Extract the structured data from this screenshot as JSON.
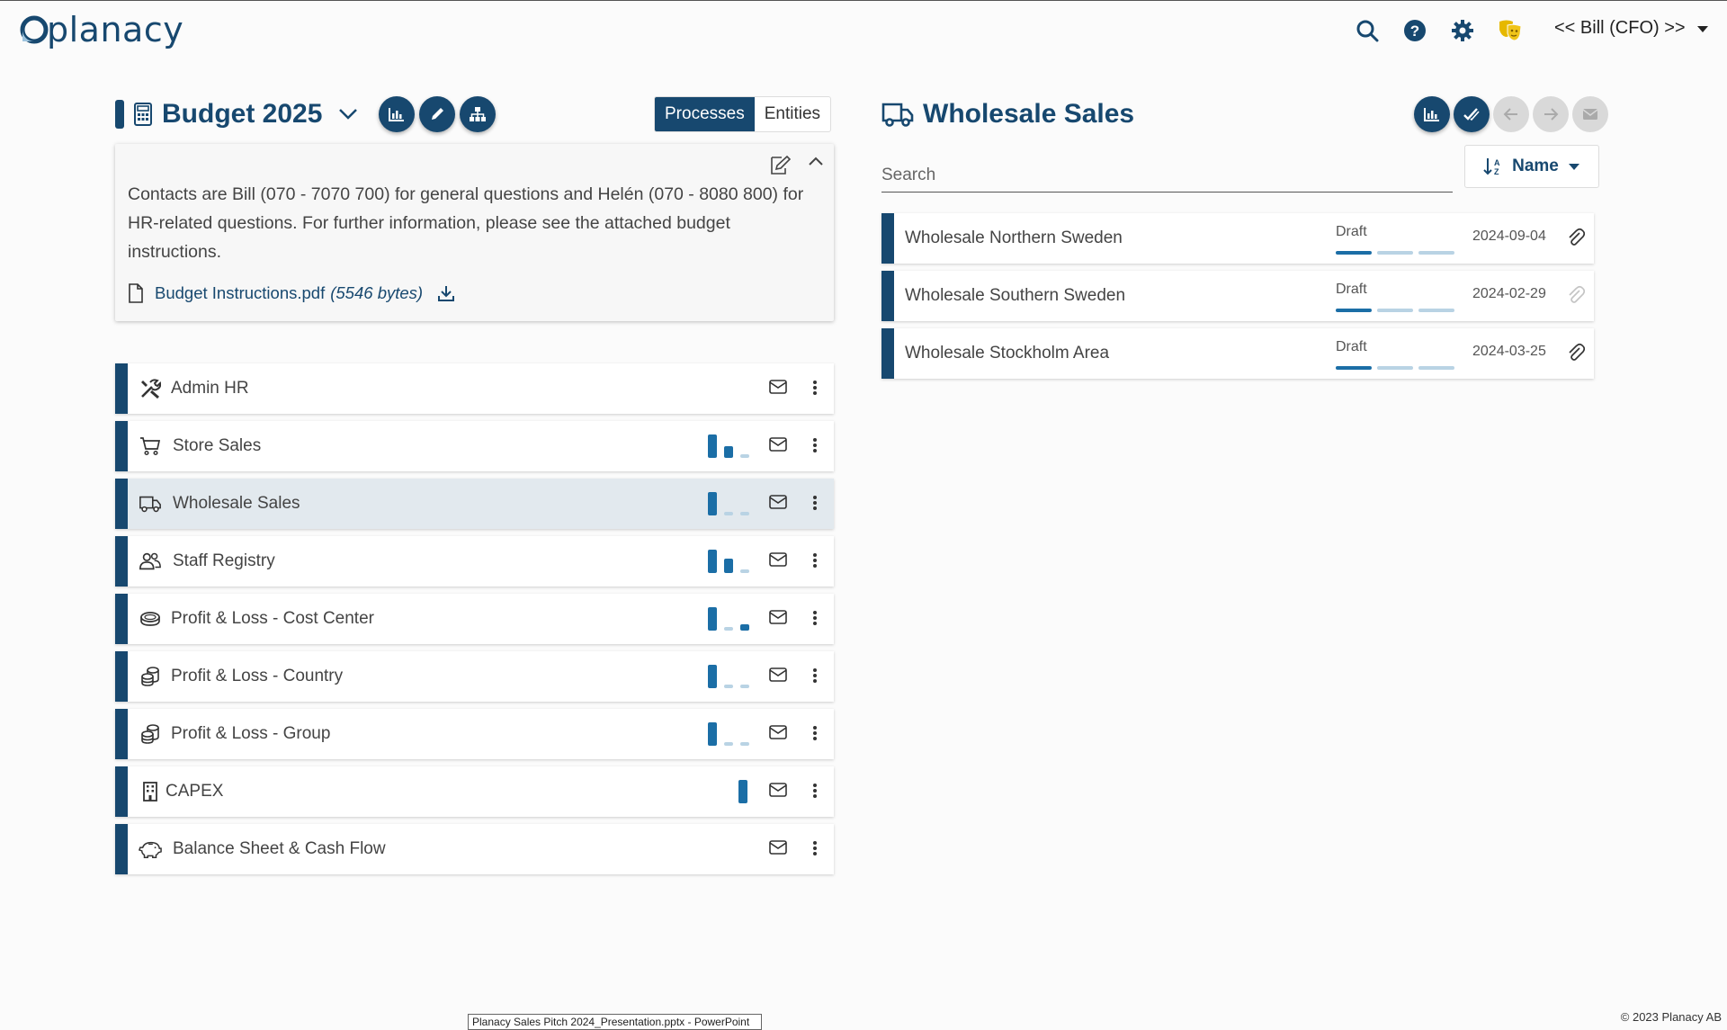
{
  "app": {
    "logo_text": "planacy",
    "user_label": "<< Bill (CFO) >>"
  },
  "left": {
    "title": "Budget 2025",
    "tabs": {
      "processes": "Processes",
      "entities": "Entities"
    },
    "info_text": "Contacts are Bill  (070 - 7070 700) for general questions and Helén (070 - 8080 800) for HR-related questions. For further information, please see the attached budget instructions.",
    "attachment": {
      "name": "Budget Instructions.pdf",
      "size": "(5546 bytes)"
    },
    "processes": [
      {
        "label": "Admin HR",
        "icon": "tools-icon",
        "progress": []
      },
      {
        "label": "Store Sales",
        "icon": "cart-icon",
        "progress": [
          1,
          0.5,
          0.15
        ]
      },
      {
        "label": "Wholesale Sales",
        "icon": "truck-icon",
        "progress": [
          1,
          0.15,
          0.15
        ],
        "selected": true
      },
      {
        "label": "Staff Registry",
        "icon": "users-icon",
        "progress": [
          1,
          0.6,
          0.15
        ]
      },
      {
        "label": "Profit & Loss - Cost Center",
        "icon": "coins-icon",
        "progress": [
          1,
          0.15,
          0.25
        ]
      },
      {
        "label": "Profit & Loss - Country",
        "icon": "coins-stack-icon",
        "progress": [
          1,
          0.15,
          0.15
        ]
      },
      {
        "label": "Profit & Loss - Group",
        "icon": "coins-stack-icon",
        "progress": [
          1,
          0.15,
          0.15
        ]
      },
      {
        "label": "CAPEX",
        "icon": "building-icon",
        "progress": [
          1
        ]
      },
      {
        "label": "Balance Sheet & Cash Flow",
        "icon": "piggy-bank-icon",
        "progress": []
      }
    ]
  },
  "right": {
    "title": "Wholesale Sales",
    "search_placeholder": "Search",
    "sort_label": "Name",
    "entities": [
      {
        "label": "Wholesale Northern Sweden",
        "status": "Draft",
        "date": "2024-09-04",
        "attachment": true
      },
      {
        "label": "Wholesale Southern Sweden",
        "status": "Draft",
        "date": "2024-02-29",
        "attachment": false
      },
      {
        "label": "Wholesale Stockholm Area",
        "status": "Draft",
        "date": "2024-03-25",
        "attachment": true
      }
    ]
  },
  "footer": {
    "copyright": "© 2023 Planacy AB"
  },
  "taskbar_tooltip": "Planacy Sales Pitch 2024_Presentation.pptx - PowerPoint",
  "colors": {
    "primary": "#17486f",
    "accent": "#1b6ea6",
    "light": "#b9d3e4",
    "theater": "#e6b800"
  }
}
